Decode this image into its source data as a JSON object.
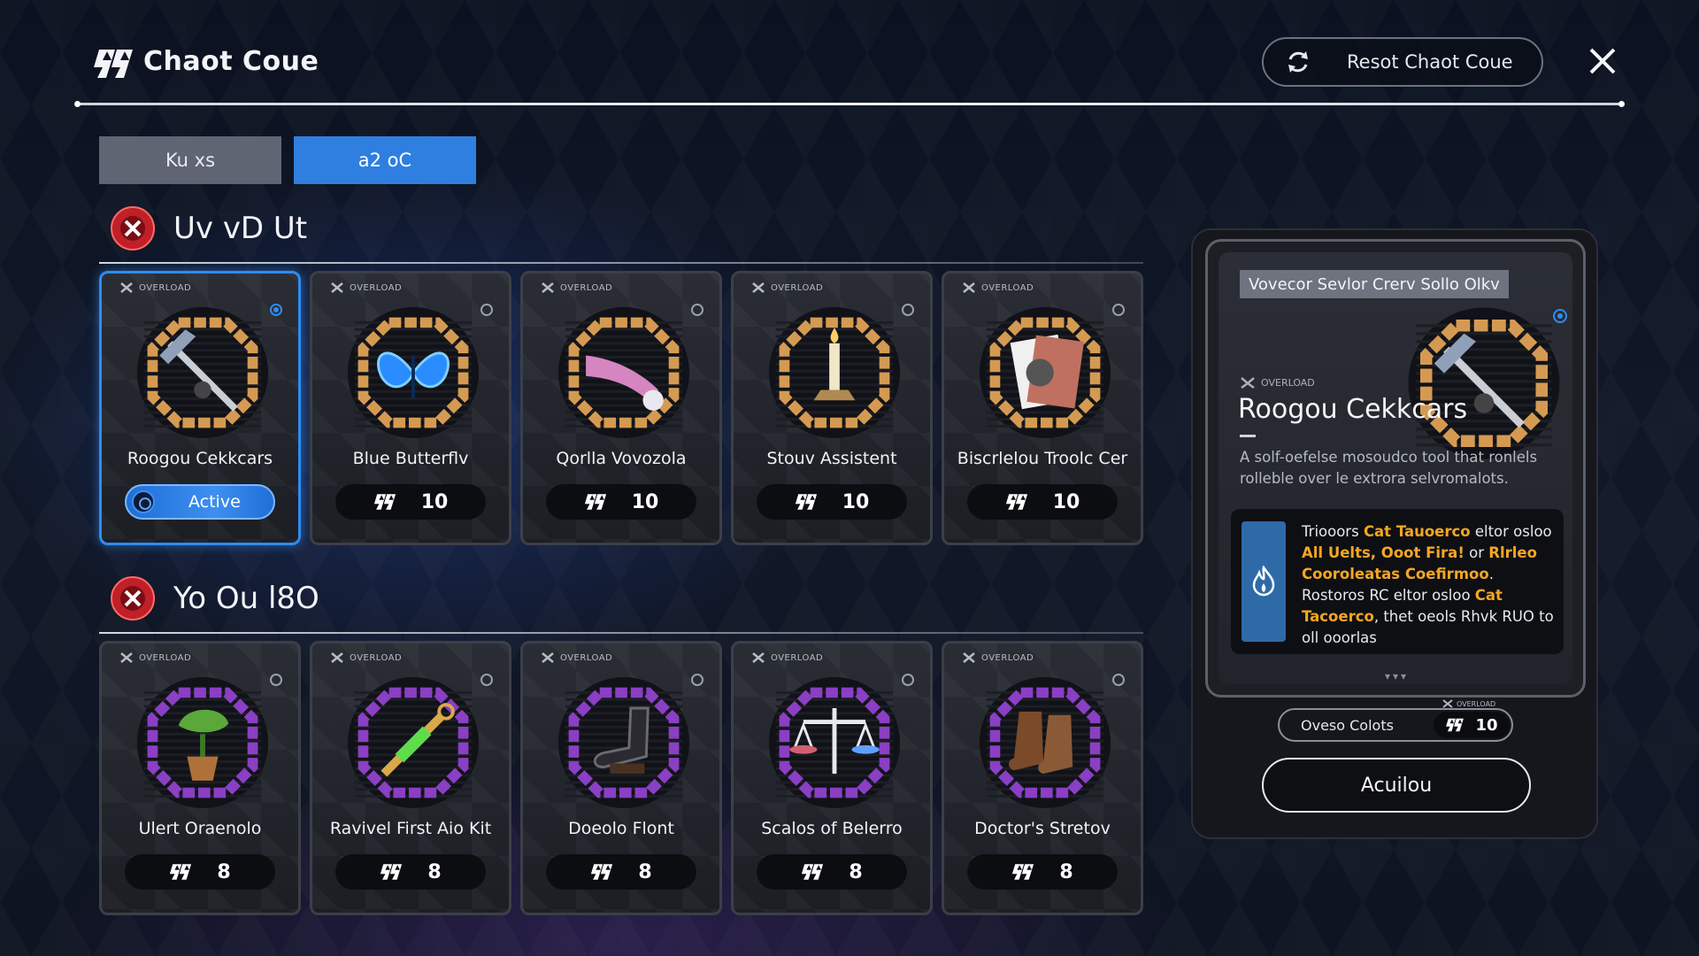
{
  "header": {
    "title": "Chaot Coue",
    "reset_label": "Resot Chaot Coue"
  },
  "tabs": [
    {
      "label": "Ku xs",
      "active": false
    },
    {
      "label": "a2 oC",
      "active": true
    }
  ],
  "sections": [
    {
      "title": "Uv vD Ut",
      "ring_color": "#d59a52",
      "cards": [
        {
          "name": "Roogou Cekkcars",
          "overload": "OVERLOAD",
          "cost": "",
          "active": true,
          "active_label": "Active",
          "icon": "pickaxe-medal-icon"
        },
        {
          "name": "Blue Butterflv",
          "overload": "OVERLOAD",
          "cost": "10",
          "active": false,
          "icon": "butterfly-medal-icon"
        },
        {
          "name": "Qorlla Vovozola",
          "overload": "OVERLOAD",
          "cost": "10",
          "active": false,
          "icon": "horn-medal-icon"
        },
        {
          "name": "Stouv Assistent",
          "overload": "OVERLOAD",
          "cost": "10",
          "active": false,
          "icon": "candle-medal-icon"
        },
        {
          "name": "Biscrlelou Troolc Cer",
          "overload": "OVERLOAD",
          "cost": "10",
          "active": false,
          "icon": "cards-medal-icon"
        }
      ]
    },
    {
      "title": "Yo Ou l8O",
      "ring_color": "#8a3fc4",
      "cards": [
        {
          "name": "Ulert      Oraenolo",
          "overload": "OVERLOAD",
          "cost": "8",
          "active": false,
          "icon": "plant-medal-icon"
        },
        {
          "name": "Ravivel First Aio Kit",
          "overload": "OVERLOAD",
          "cost": "8",
          "active": false,
          "icon": "syringe-medal-icon"
        },
        {
          "name": "Doeolo Flont",
          "overload": "OVERLOAD",
          "cost": "8",
          "active": false,
          "icon": "boot-medal-icon"
        },
        {
          "name": "Scalos of Belerro",
          "overload": "OVERLOAD",
          "cost": "8",
          "active": false,
          "icon": "scales-medal-icon"
        },
        {
          "name": "Doctor's Stretov",
          "overload": "OVERLOAD",
          "cost": "8",
          "active": false,
          "icon": "boots-medal-icon"
        }
      ]
    }
  ],
  "detail": {
    "banner": "Vovecor Sevlor Crerv Sollo Olkv",
    "overload": "OVERLOAD",
    "name": "Roogou Cekkcars",
    "description": "A solf-oefelse mosoudco tool that ronlels rolleble over le extrora selvromalots.",
    "effect_parts": [
      {
        "text": "Triooors ",
        "hl": false
      },
      {
        "text": "Cat Tauoerco",
        "hl": true
      },
      {
        "text": " eltor osloo ",
        "hl": false
      },
      {
        "text": "All Uelts, Ooot Fira!",
        "hl": true
      },
      {
        "text": " or ",
        "hl": false
      },
      {
        "text": "Rlrleo Cooroleatas Coefirmoo",
        "hl": true
      },
      {
        "text": ". Rostoros RC eltor osloo ",
        "hl": false
      },
      {
        "text": "Cat Tacoerco",
        "hl": true
      },
      {
        "text": ", thet oeols Rhvk RUO to oll ooorlas",
        "hl": false
      }
    ],
    "more": "▾▾▾",
    "cost_label": "Oveso Colots",
    "cost_value": "10",
    "cost_tag": "OVERLOAD",
    "activate_label": "Acuilou"
  },
  "colors": {
    "accent": "#2f8cf0",
    "highlight": "#f4a623",
    "section_icon": "#c02028"
  }
}
